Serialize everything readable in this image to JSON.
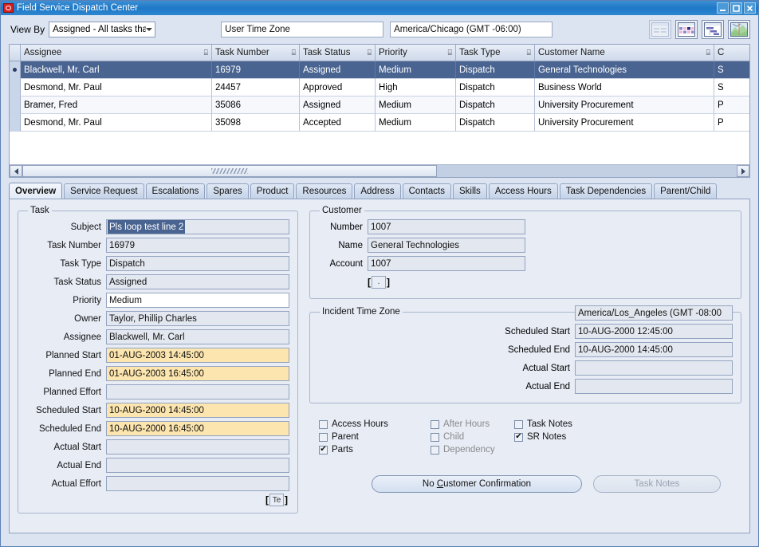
{
  "window": {
    "title": "Field Service Dispatch Center",
    "logo_icon": "oracle-logo-icon",
    "minimize_label": "Minimize",
    "maximize_label": "Maximize",
    "close_label": "Close"
  },
  "toolbar": {
    "view_by_label": "View By",
    "view_by_value": "Assigned - All tasks that are a...",
    "user_time_zone_label": "User Time Zone",
    "user_time_zone_value": "America/Chicago (GMT -06:00)",
    "icons": [
      {
        "name": "list-view-icon",
        "label": "List View",
        "disabled": true
      },
      {
        "name": "calendar-view-icon",
        "label": "Calendar View",
        "disabled": false
      },
      {
        "name": "gantt-view-icon",
        "label": "Gantt View",
        "disabled": false
      },
      {
        "name": "map-view-icon",
        "label": "Map View",
        "disabled": false
      }
    ]
  },
  "table": {
    "columns": [
      {
        "key": "assignee",
        "label": "Assignee"
      },
      {
        "key": "task_number",
        "label": "Task Number"
      },
      {
        "key": "task_status",
        "label": "Task Status"
      },
      {
        "key": "priority",
        "label": "Priority"
      },
      {
        "key": "task_type",
        "label": "Task Type"
      },
      {
        "key": "customer_name",
        "label": "Customer Name"
      },
      {
        "key": "extra",
        "label": "C"
      }
    ],
    "rows": [
      {
        "assignee": "Blackwell, Mr. Carl",
        "task_number": "16979",
        "task_status": "Assigned",
        "priority": "Medium",
        "task_type": "Dispatch",
        "customer_name": "General Technologies",
        "extra": "S",
        "selected": true
      },
      {
        "assignee": "Desmond, Mr. Paul",
        "task_number": "24457",
        "task_status": "Approved",
        "priority": "High",
        "task_type": "Dispatch",
        "customer_name": "Business World",
        "extra": "S",
        "selected": false
      },
      {
        "assignee": "Bramer, Fred",
        "task_number": "35086",
        "task_status": "Assigned",
        "priority": "Medium",
        "task_type": "Dispatch",
        "customer_name": "University Procurement",
        "extra": "P",
        "selected": false
      },
      {
        "assignee": "Desmond, Mr. Paul",
        "task_number": "35098",
        "task_status": "Accepted",
        "priority": "Medium",
        "task_type": "Dispatch",
        "customer_name": "University Procurement",
        "extra": "P",
        "selected": false
      }
    ]
  },
  "tabs": [
    {
      "label": "Overview",
      "active": true
    },
    {
      "label": "Service Request",
      "active": false
    },
    {
      "label": "Escalations",
      "active": false
    },
    {
      "label": "Spares",
      "active": false
    },
    {
      "label": "Product",
      "active": false
    },
    {
      "label": "Resources",
      "active": false
    },
    {
      "label": "Address",
      "active": false
    },
    {
      "label": "Contacts",
      "active": false
    },
    {
      "label": "Skills",
      "active": false
    },
    {
      "label": "Access Hours",
      "active": false
    },
    {
      "label": "Task Dependencies",
      "active": false
    },
    {
      "label": "Parent/Child",
      "active": false
    }
  ],
  "task_group": {
    "legend": "Task",
    "fields": [
      {
        "label": "Subject",
        "value": "Pls loop test line 2",
        "style": "selected"
      },
      {
        "label": "Task Number",
        "value": "16979",
        "style": "readonly"
      },
      {
        "label": "Task Type",
        "value": "Dispatch",
        "style": "readonly"
      },
      {
        "label": "Task Status",
        "value": "Assigned",
        "style": "readonly"
      },
      {
        "label": "Priority",
        "value": "Medium",
        "style": "white"
      },
      {
        "label": "Owner",
        "value": "Taylor, Phillip Charles",
        "style": "readonly"
      },
      {
        "label": "Assignee",
        "value": "Blackwell, Mr. Carl",
        "style": "readonly"
      },
      {
        "label": "Planned Start",
        "value": "01-AUG-2003 14:45:00",
        "style": "yellow"
      },
      {
        "label": "Planned End",
        "value": "01-AUG-2003 16:45:00",
        "style": "yellow"
      },
      {
        "label": "Planned Effort",
        "value": "",
        "style": "readonly"
      },
      {
        "label": "Scheduled Start",
        "value": "10-AUG-2000 14:45:00",
        "style": "yellow"
      },
      {
        "label": "Scheduled End",
        "value": "10-AUG-2000 16:45:00",
        "style": "yellow"
      },
      {
        "label": "Actual Start",
        "value": "",
        "style": "readonly"
      },
      {
        "label": "Actual End",
        "value": "",
        "style": "readonly"
      },
      {
        "label": "Actual Effort",
        "value": "",
        "style": "readonly"
      }
    ],
    "lov_button_label": "Te",
    "bracket_open": "[",
    "bracket_close": "]"
  },
  "customer_group": {
    "legend": "Customer",
    "fields": [
      {
        "label": "Number",
        "value": "1007"
      },
      {
        "label": "Name",
        "value": "General Technologies"
      },
      {
        "label": "Account",
        "value": "1007"
      }
    ],
    "lov_button_label": ".",
    "bracket_open": "[",
    "bracket_close": "]"
  },
  "incident_group": {
    "legend": "Incident Time Zone",
    "time_zone_value": "America/Los_Angeles (GMT -08:00",
    "fields": [
      {
        "label": "Scheduled Start",
        "value": "10-AUG-2000 12:45:00"
      },
      {
        "label": "Scheduled End",
        "value": "10-AUG-2000 14:45:00"
      },
      {
        "label": "Actual Start",
        "value": ""
      },
      {
        "label": "Actual End",
        "value": ""
      }
    ]
  },
  "checkboxes": [
    {
      "label": "Access Hours",
      "checked": false,
      "dim": false
    },
    {
      "label": "After Hours",
      "checked": false,
      "dim": true
    },
    {
      "label": "Task Notes",
      "checked": false,
      "dim": false
    },
    {
      "label": "Parent",
      "checked": false,
      "dim": false
    },
    {
      "label": "Child",
      "checked": false,
      "dim": true
    },
    {
      "label": "SR Notes",
      "checked": true,
      "dim": false
    },
    {
      "label": "Parts",
      "checked": true,
      "dim": false
    },
    {
      "label": "Dependency",
      "checked": false,
      "dim": true
    },
    {
      "label": "",
      "checked": false,
      "dim": false
    }
  ],
  "buttons": {
    "customer_confirmation": "No Customer Confirmation",
    "customer_confirmation_mnemonic": "C",
    "task_notes": "Task Notes",
    "task_notes_disabled": true
  },
  "colors": {
    "titlebar": "#1d78c6",
    "selection": "#4a6491",
    "required_field": "#fce5ae",
    "panel_bg": "#e7ecf5"
  }
}
